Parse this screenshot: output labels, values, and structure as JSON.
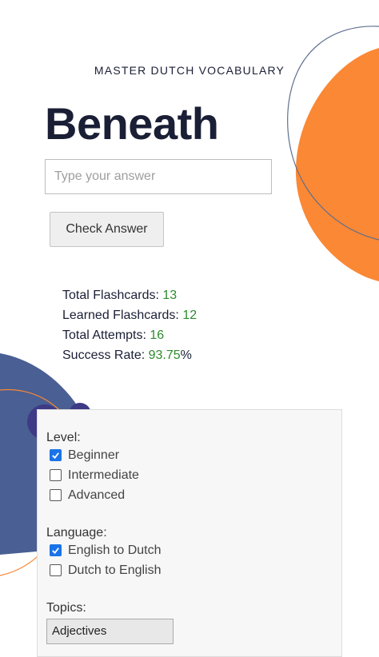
{
  "header": {
    "subtitle": "MASTER DUTCH VOCABULARY"
  },
  "flashcard": {
    "word": "Beneath"
  },
  "answer": {
    "placeholder": "Type your answer",
    "value": ""
  },
  "check_button": {
    "label": "Check Answer"
  },
  "stats": [
    {
      "label": "Total Flashcards: ",
      "value": "13",
      "suffix": ""
    },
    {
      "label": "Learned Flashcards: ",
      "value": "12",
      "suffix": ""
    },
    {
      "label": "Total Attempts: ",
      "value": "16",
      "suffix": ""
    },
    {
      "label": "Success Rate: ",
      "value": "93.75",
      "suffix": "%"
    }
  ],
  "filters": {
    "level": {
      "label": "Level:",
      "options": [
        {
          "label": "Beginner",
          "checked": true
        },
        {
          "label": "Intermediate",
          "checked": false
        },
        {
          "label": "Advanced",
          "checked": false
        }
      ]
    },
    "language": {
      "label": "Language:",
      "options": [
        {
          "label": "English to Dutch",
          "checked": true
        },
        {
          "label": "Dutch to English",
          "checked": false
        }
      ]
    },
    "topics": {
      "label": "Topics:",
      "selected": "Adjectives"
    }
  },
  "colors": {
    "accent_orange": "#FB8834",
    "accent_navy": "#4A5F93",
    "text_dark": "#1A1F36",
    "stat_value": "#2E8B2E",
    "checkbox_checked": "#1A73E8"
  }
}
